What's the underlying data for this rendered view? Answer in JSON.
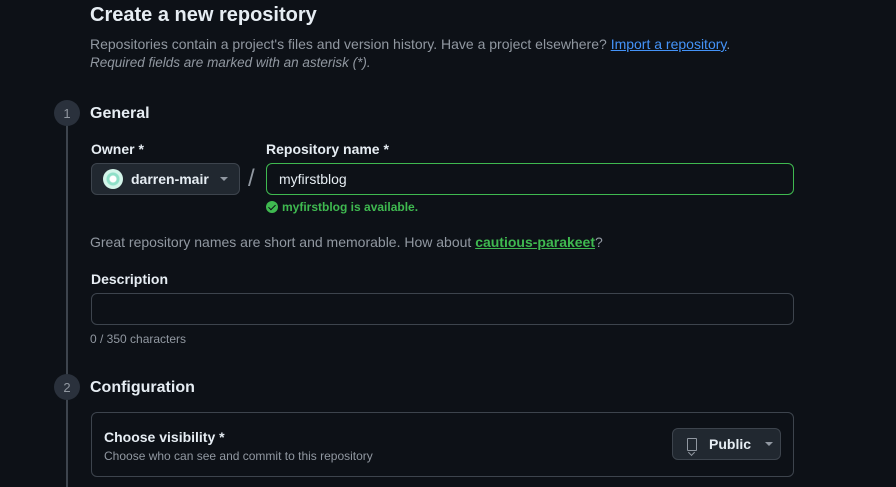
{
  "header": {
    "title": "Create a new repository",
    "intro_text": "Repositories contain a project's files and version history. Have a project elsewhere? ",
    "import_link": "Import a repository",
    "intro_end": ".",
    "required_note": "Required fields are marked with an asterisk (*)."
  },
  "steps": [
    {
      "number": "1",
      "title": "General"
    },
    {
      "number": "2",
      "title": "Configuration"
    }
  ],
  "general": {
    "owner_label": "Owner *",
    "owner_value": "darren-mair",
    "separator": "/",
    "repo_name_label": "Repository name *",
    "repo_name_value": "myfirstblog",
    "availability": "myfirstblog is available.",
    "suggestion_prefix": "Great repository names are short and memorable. How about ",
    "suggestion_name": "cautious-parakeet",
    "suggestion_suffix": "?",
    "description_label": "Description",
    "description_value": "",
    "char_count": "0 / 350 characters"
  },
  "configuration": {
    "visibility_title": "Choose visibility *",
    "visibility_subtitle": "Choose who can see and commit to this repository",
    "visibility_value": "Public"
  },
  "colors": {
    "background": "#0d1117",
    "success": "#3fb950",
    "link": "#4493f8",
    "border": "#3d444d"
  }
}
